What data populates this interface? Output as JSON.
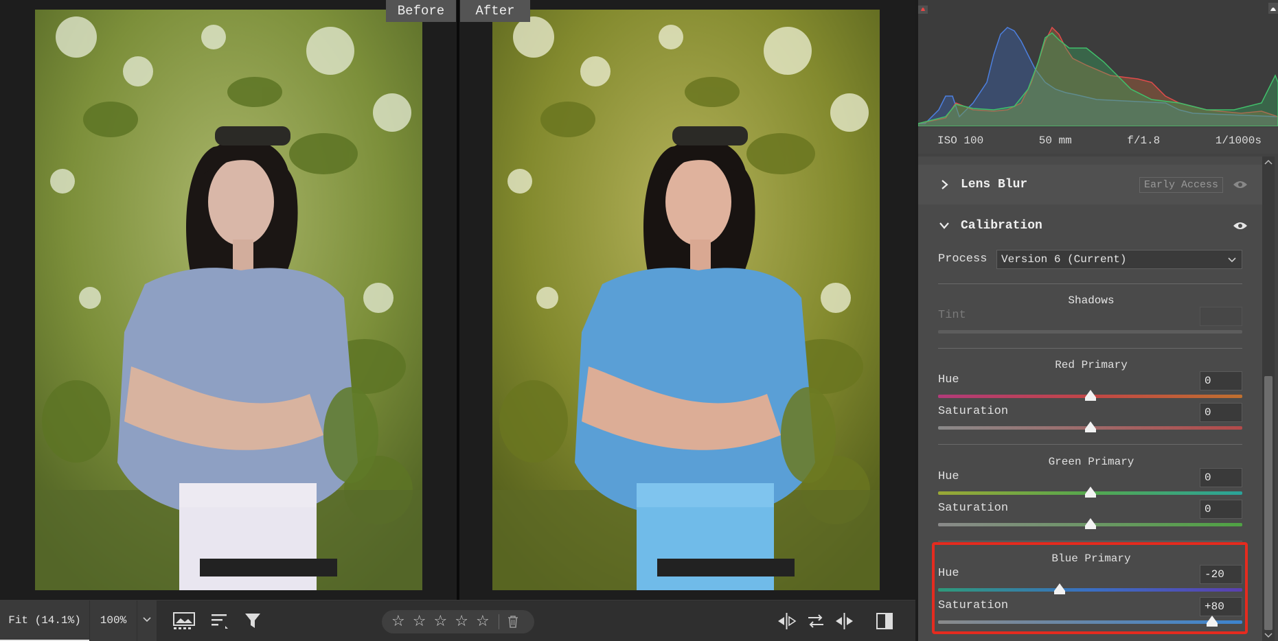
{
  "canvas": {
    "before_label": "Before",
    "after_label": "After"
  },
  "toolbar": {
    "zoom_fit_label": "Fit (14.1%)",
    "zoom_100_label": "100%",
    "rating_stars": [
      "☆",
      "☆",
      "☆",
      "☆",
      "☆"
    ]
  },
  "histogram": {
    "colors": {
      "red": "#e74c4c",
      "green": "#3dbf6a",
      "blue": "#3c6fd1"
    }
  },
  "camera_info": {
    "iso": "ISO 100",
    "focal_length": "50 mm",
    "aperture": "f/1.8",
    "shutter": "1/1000s"
  },
  "lens_blur": {
    "title": "Lens Blur",
    "badge": "Early Access"
  },
  "calibration": {
    "title": "Calibration",
    "process_label": "Process",
    "process_value": "Version 6 (Current)",
    "shadows": {
      "title": "Shadows",
      "tint_label": "Tint",
      "tint_value": ""
    },
    "red_primary": {
      "title": "Red Primary",
      "hue_label": "Hue",
      "hue_value": "0",
      "hue_pos": 0.5,
      "sat_label": "Saturation",
      "sat_value": "0",
      "sat_pos": 0.5
    },
    "green_primary": {
      "title": "Green Primary",
      "hue_label": "Hue",
      "hue_value": "0",
      "hue_pos": 0.5,
      "sat_label": "Saturation",
      "sat_value": "0",
      "sat_pos": 0.5
    },
    "blue_primary": {
      "title": "Blue Primary",
      "hue_label": "Hue",
      "hue_value": "-20",
      "hue_pos": 0.4,
      "sat_label": "Saturation",
      "sat_value": "+80",
      "sat_pos": 0.9
    }
  },
  "highlight_color": "#e52b1f"
}
